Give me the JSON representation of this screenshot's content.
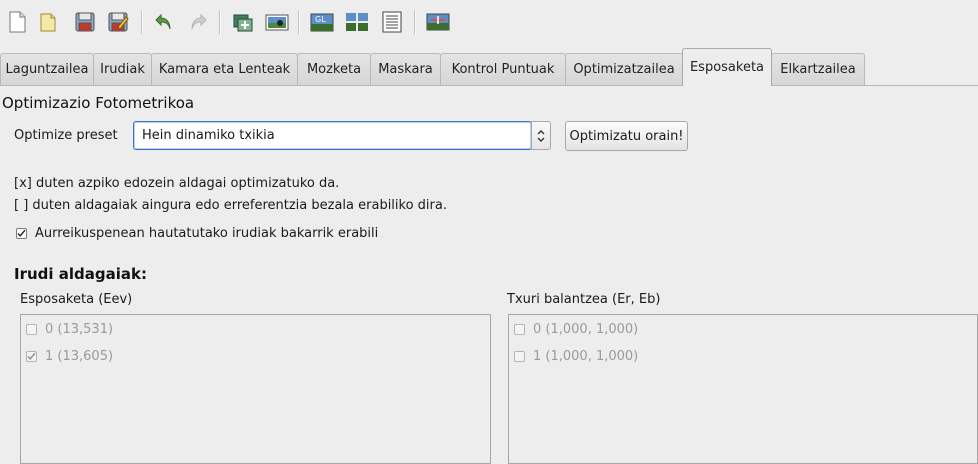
{
  "toolbar": {
    "icons": [
      "new-project-icon",
      "open-project-icon",
      "save-icon",
      "save-as-icon",
      "undo-icon",
      "redo-icon",
      "add-images-icon",
      "preview-icon",
      "gl-preview-icon",
      "layout-icon",
      "table-icon",
      "straighten-icon"
    ],
    "gl_text": "GL"
  },
  "tabs": [
    {
      "label": "Laguntzailea"
    },
    {
      "label": "Irudiak"
    },
    {
      "label": "Kamara eta Lenteak"
    },
    {
      "label": "Mozketa"
    },
    {
      "label": "Maskara"
    },
    {
      "label": "Kontrol Puntuak"
    },
    {
      "label": "Optimizatzailea"
    },
    {
      "label": "Esposaketa"
    },
    {
      "label": "Elkartzailea"
    }
  ],
  "main": {
    "section_title": "Optimizazio Fotometrikoa",
    "preset_label": "Optimize preset",
    "preset_value": "Hein dinamiko txikia",
    "optimize_button": "Optimizatu orain!",
    "info_line1": "[x] duten azpiko edozein aldagai optimizatuko da.",
    "info_line2": "[ ] duten aldagaiak aingura edo erreferentzia bezala erabiliko dira.",
    "preview_only_label": "Aurreikuspenean hautatutako irudiak bakarrik erabili",
    "preview_only_checked": true,
    "image_vars_title": "Irudi aldagaiak:",
    "exposure": {
      "title": "Esposaketa (Eev)",
      "items": [
        {
          "label": "0 (13,531)",
          "checked": false
        },
        {
          "label": "1 (13,605)",
          "checked": true
        }
      ]
    },
    "white_balance": {
      "title": "Txuri balantzea (Er, Eb)",
      "items": [
        {
          "label": "0 (1,000, 1,000)",
          "checked": false
        },
        {
          "label": "1 (1,000, 1,000)",
          "checked": false
        }
      ]
    }
  },
  "colors": {
    "accent": "#3b74b8",
    "disabled_text": "#9a9a9a"
  }
}
